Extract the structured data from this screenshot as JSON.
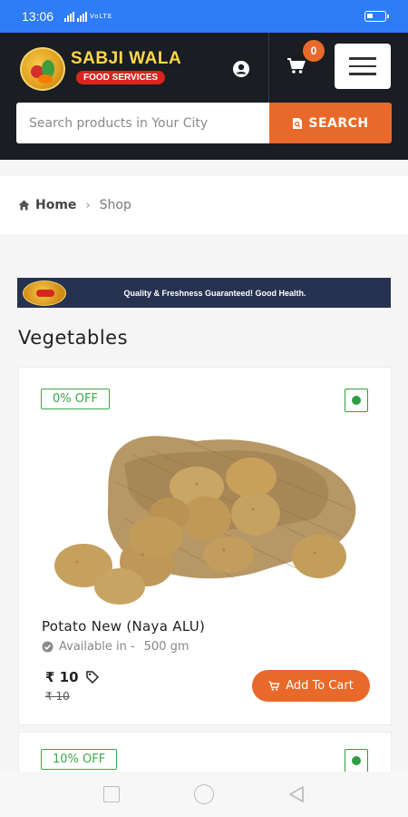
{
  "status_bar": {
    "time": "13:06",
    "signal_text": "VoLTE",
    "battery_icon": "battery-icon"
  },
  "header": {
    "logo_title": "SABJI WALA",
    "logo_subtitle": "FOOD SERVICES",
    "user_icon": "user-circle-icon",
    "cart_icon": "cart-icon",
    "cart_count": "0",
    "menu_icon": "hamburger-menu-icon",
    "bg_color": "#1a1d21",
    "accent_color": "#e8692a"
  },
  "search": {
    "placeholder": "Search products in Your City",
    "value": "",
    "button_label": "SEARCH",
    "button_icon": "search-document-icon"
  },
  "breadcrumb": {
    "home_label": "Home",
    "home_icon": "home-icon",
    "separator_icon": "chevron-right-icon",
    "current": "Shop"
  },
  "banner": {
    "text": "Quality & Freshness Guaranteed! Good Health.",
    "bg_color": "#26324f"
  },
  "section": {
    "title": "Vegetables"
  },
  "products": [
    {
      "discount": "0% OFF",
      "name": "Potato New (Naya ALU)",
      "availability_label": "Available in -",
      "availability_value": "500 gm",
      "price": "₹ 10",
      "mrp": "₹ 10",
      "add_to_cart_label": "Add To Cart",
      "veg": true
    },
    {
      "discount": "10% OFF",
      "veg": true
    }
  ],
  "nav": {
    "recent_icon": "square-icon",
    "home_icon": "circle-icon",
    "back_icon": "triangle-back-icon"
  }
}
